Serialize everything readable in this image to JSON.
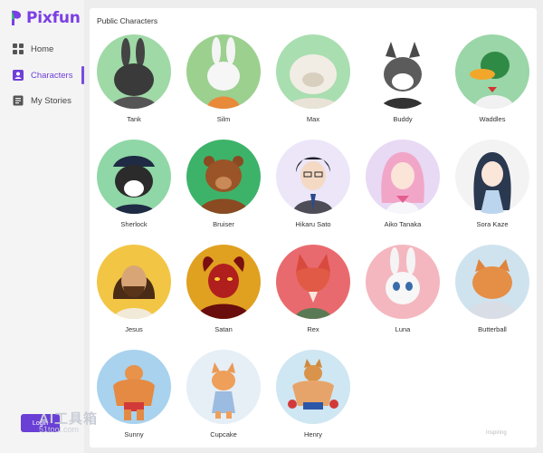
{
  "app": {
    "logo_text": "Pixfun",
    "brand_color": "#7b3fe4",
    "accent_color": "#6a3fd6"
  },
  "sidebar": {
    "items": [
      {
        "label": "Home",
        "icon": "grid-icon",
        "active": false
      },
      {
        "label": "Characters",
        "icon": "person-card-icon",
        "active": true
      },
      {
        "label": "My Stories",
        "icon": "book-icon",
        "active": false
      }
    ],
    "login_label": "Login"
  },
  "main": {
    "title": "Public Characters",
    "characters": [
      {
        "name": "Tank",
        "bg": "#9fd9a6",
        "kind": "rabbit-dark"
      },
      {
        "name": "Silm",
        "bg": "#9bd08f",
        "kind": "rabbit-white"
      },
      {
        "name": "Max",
        "bg": "#a9deb0",
        "kind": "bulldog"
      },
      {
        "name": "Buddy",
        "bg": "#ffffff",
        "kind": "husky"
      },
      {
        "name": "Waddles",
        "bg": "#9ad6a8",
        "kind": "duck"
      },
      {
        "name": "Sherlock",
        "bg": "#8fd7a6",
        "kind": "dog-police"
      },
      {
        "name": "Bruiser",
        "bg": "#3db36a",
        "kind": "bear"
      },
      {
        "name": "Hikaru Sato",
        "bg": "#ece6f8",
        "kind": "anime-boy"
      },
      {
        "name": "Aiko Tanaka",
        "bg": "#e8d9f4",
        "kind": "anime-girl-pink"
      },
      {
        "name": "Sora Kaze",
        "bg": "#f3f3f3",
        "kind": "anime-girl-dark"
      },
      {
        "name": "Jesus",
        "bg": "#f2c544",
        "kind": "man-beard"
      },
      {
        "name": "Satan",
        "bg": "#e0a020",
        "kind": "devil"
      },
      {
        "name": "Rex",
        "bg": "#e96a6e",
        "kind": "fox"
      },
      {
        "name": "Luna",
        "bg": "#f4b7bf",
        "kind": "rabbit-luna"
      },
      {
        "name": "Butterball",
        "bg": "#cfe3ef",
        "kind": "cat-fat"
      },
      {
        "name": "Sunny",
        "bg": "#a8d2ee",
        "kind": "muscle-cat"
      },
      {
        "name": "Cupcake",
        "bg": "#e6eef6",
        "kind": "kitten"
      },
      {
        "name": "Henry",
        "bg": "#cfe6f3",
        "kind": "muscle-dog"
      }
    ]
  },
  "watermark": {
    "main": "AI工具箱",
    "sub": "51tool.com"
  },
  "corner_note": "Inspiring"
}
